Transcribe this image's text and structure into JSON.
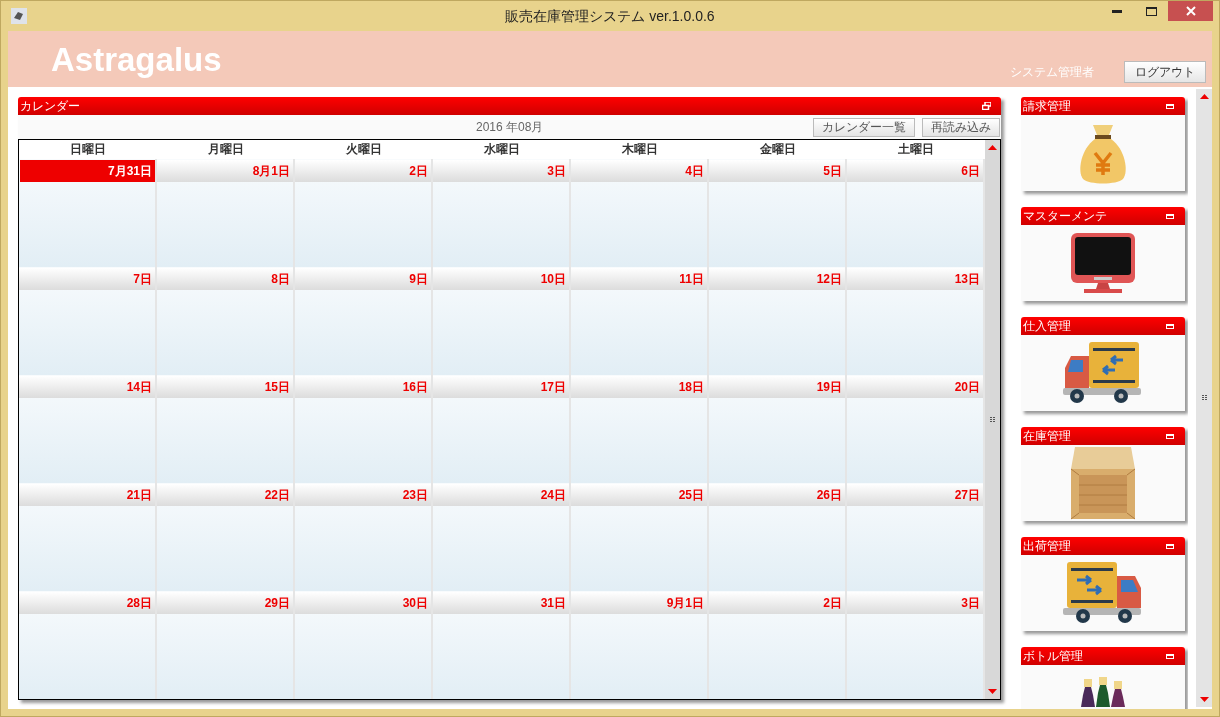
{
  "window": {
    "title": "販売在庫管理システム ver.1.0.0.6"
  },
  "header": {
    "logo": "Astragalus",
    "user": "システム管理者",
    "logout": "ログアウト"
  },
  "calendar": {
    "title": "カレンダー",
    "month": "2016 年08月",
    "buttons": [
      "カレンダー一覧",
      "再読み込み"
    ],
    "weekdays": [
      "日曜日",
      "月曜日",
      "火曜日",
      "水曜日",
      "木曜日",
      "金曜日",
      "土曜日"
    ],
    "weeks": [
      [
        {
          "label": "7月31日",
          "selected": true
        },
        {
          "label": "8月1日",
          "selected": false
        },
        {
          "label": "2日",
          "selected": false
        },
        {
          "label": "3日",
          "selected": false
        },
        {
          "label": "4日",
          "selected": false
        },
        {
          "label": "5日",
          "selected": false
        },
        {
          "label": "6日",
          "selected": false
        }
      ],
      [
        {
          "label": "7日",
          "selected": false
        },
        {
          "label": "8日",
          "selected": false
        },
        {
          "label": "9日",
          "selected": false
        },
        {
          "label": "10日",
          "selected": false
        },
        {
          "label": "11日",
          "selected": false
        },
        {
          "label": "12日",
          "selected": false
        },
        {
          "label": "13日",
          "selected": false
        }
      ],
      [
        {
          "label": "14日",
          "selected": false
        },
        {
          "label": "15日",
          "selected": false
        },
        {
          "label": "16日",
          "selected": false
        },
        {
          "label": "17日",
          "selected": false
        },
        {
          "label": "18日",
          "selected": false
        },
        {
          "label": "19日",
          "selected": false
        },
        {
          "label": "20日",
          "selected": false
        }
      ],
      [
        {
          "label": "21日",
          "selected": false
        },
        {
          "label": "22日",
          "selected": false
        },
        {
          "label": "23日",
          "selected": false
        },
        {
          "label": "24日",
          "selected": false
        },
        {
          "label": "25日",
          "selected": false
        },
        {
          "label": "26日",
          "selected": false
        },
        {
          "label": "27日",
          "selected": false
        }
      ],
      [
        {
          "label": "28日",
          "selected": false
        },
        {
          "label": "29日",
          "selected": false
        },
        {
          "label": "30日",
          "selected": false
        },
        {
          "label": "31日",
          "selected": false
        },
        {
          "label": "9月1日",
          "selected": false
        },
        {
          "label": "2日",
          "selected": false
        },
        {
          "label": "3日",
          "selected": false
        }
      ]
    ]
  },
  "menu": [
    {
      "title": "請求管理",
      "kind": "money"
    },
    {
      "title": "マスターメンテ",
      "kind": "monitor"
    },
    {
      "title": "仕入管理",
      "kind": "truck_in"
    },
    {
      "title": "在庫管理",
      "kind": "crate"
    },
    {
      "title": "出荷管理",
      "kind": "truck_out"
    },
    {
      "title": "ボトル管理",
      "kind": "bottles"
    }
  ]
}
